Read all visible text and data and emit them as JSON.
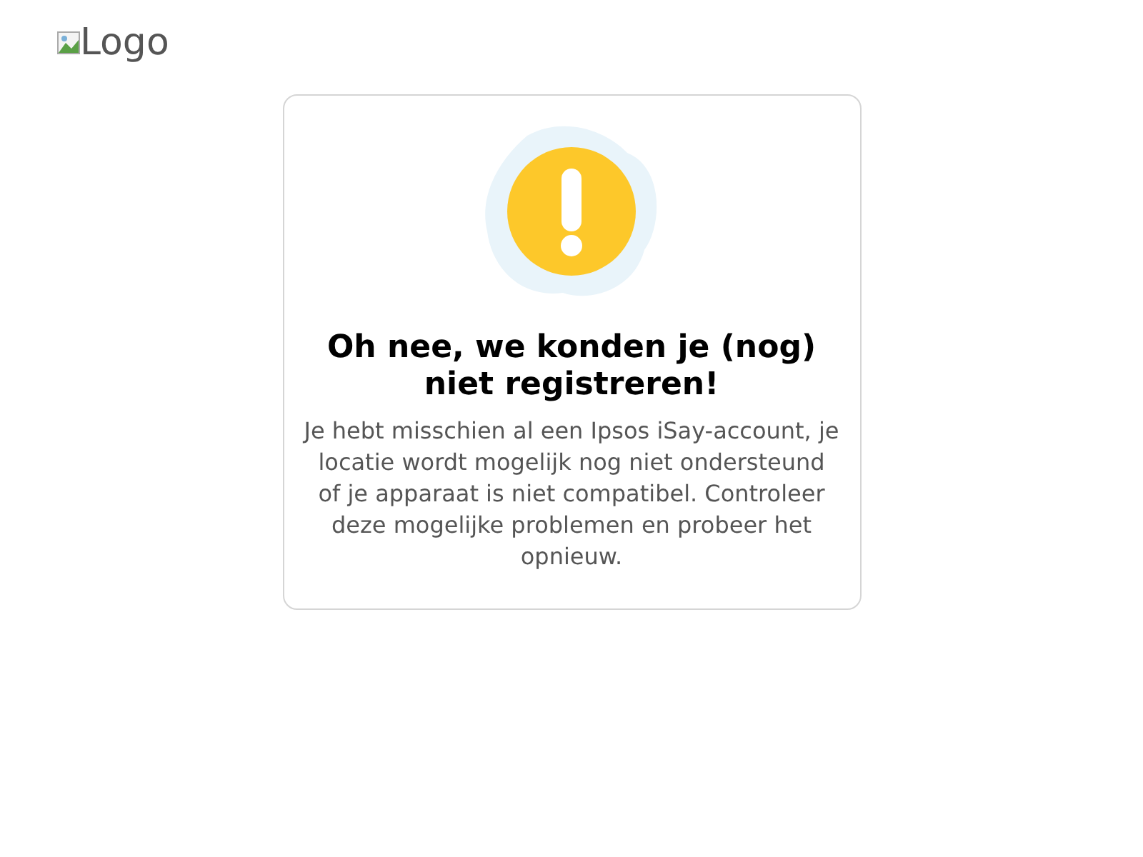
{
  "logo": {
    "alt": "Logo"
  },
  "card": {
    "title": "Oh nee, we konden je (nog) niet registreren!",
    "message": "Je hebt misschien al een Ipsos iSay-account, je locatie wordt mogelijk nog niet ondersteund of je apparaat is niet compatibel. Controleer deze mogelijke problemen en probeer het opnieuw."
  }
}
